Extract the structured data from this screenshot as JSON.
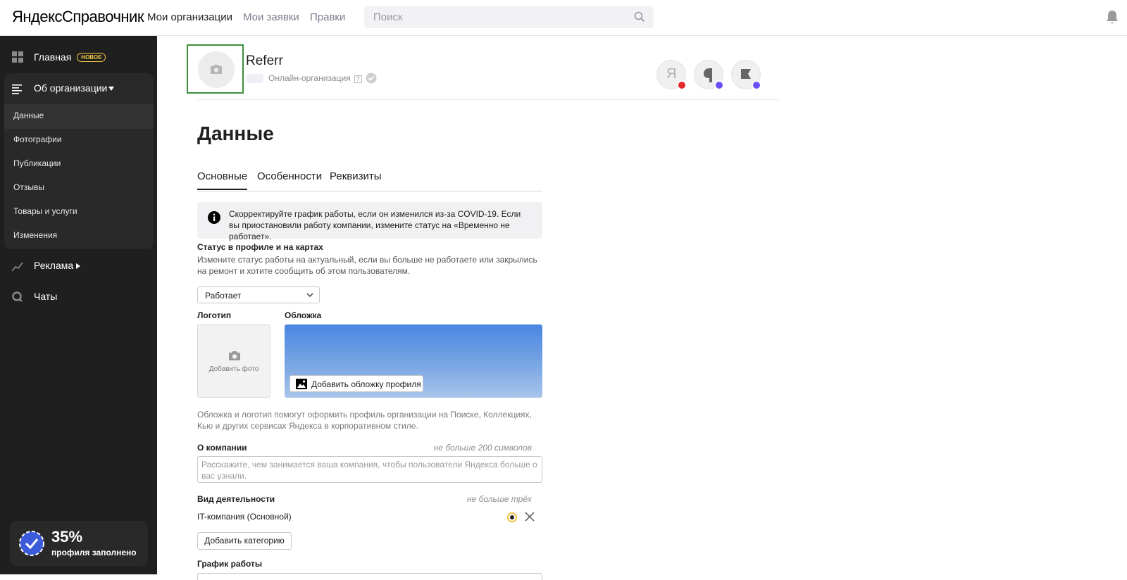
{
  "header": {
    "logo_ya": "Яндекс",
    "logo_sp": "Справочник",
    "nav": [
      "Мои организации",
      "Мои заявки",
      "Правки"
    ],
    "search_placeholder": "Поиск"
  },
  "sidebar": {
    "home": "Главная",
    "home_badge": "НОВОЕ",
    "about": "Об организации",
    "sub": [
      "Данные",
      "Фотографии",
      "Публикации",
      "Отзывы",
      "Товары и услуги",
      "Изменения"
    ],
    "ads": "Реклама",
    "chats": "Чаты",
    "progress_pct": "35%",
    "progress_label": "профиля заполнено"
  },
  "org": {
    "name": "Referr",
    "type": "Онлайн-организация",
    "q": "?"
  },
  "page": {
    "title": "Данные",
    "tabs": [
      "Основные",
      "Особенности",
      "Реквизиты"
    ],
    "notice": "Скорректируйте график работы, если он изменился из-за COVID-19. Если вы приостановили работу компании, измените статус на «Временно не работает».",
    "status_label": "Статус в профиле и на картах",
    "status_hint": "Измените статус работы на актуальный, если вы больше не работаете или закрылись на ремонт и хотите сообщить об этом пользователям.",
    "status_value": "Работает",
    "logo_label": "Логотип",
    "logo_add": "Добавить фото",
    "cover_label": "Обложка",
    "cover_btn": "Добавить обложку профиля",
    "cover_hint": "Обложка и логотип помогут оформить профиль организации на Поиске, Коллекциях, Кью и других сервисах Яндекса в корпоративном стиле.",
    "about_label": "О компании",
    "about_limit": "не больше 200 символов",
    "about_placeholder": "Расскажите, чем занимается ваша компания, чтобы пользователи Яндекса больше о вас узнали.",
    "activity_label": "Вид деятельности",
    "activity_limit": "не больше трёх",
    "activity_item": "IT-компания  (Основной)",
    "add_category": "Добавить категорию",
    "schedule_label": "График работы"
  },
  "colors": {
    "sidebar_bg": "#1f1f1f",
    "accent_yellow": "#f7c948",
    "svc_red": "#e8262e",
    "svc_purple": "#6b4ff6",
    "check_green": "#3d8f3d"
  }
}
